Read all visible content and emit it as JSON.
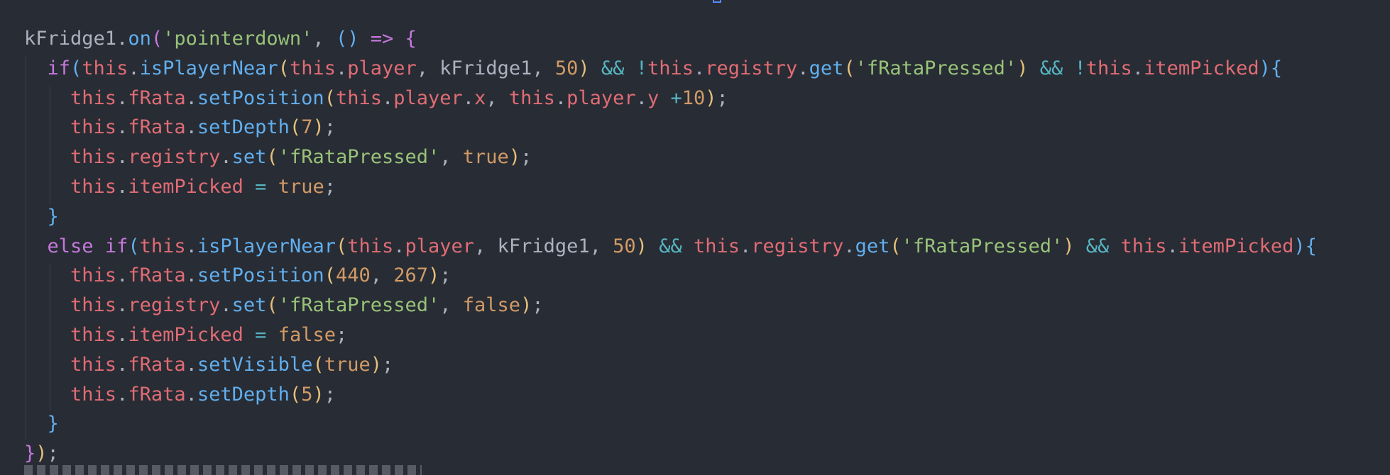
{
  "theme": {
    "background": "#282c34",
    "colors": {
      "plain": "#abb2bf",
      "keyword": "#c678dd",
      "this": "#e06c75",
      "prop": "#e06c75",
      "method": "#61afef",
      "string": "#98c379",
      "number": "#d19a66",
      "operator": "#56b6c2",
      "brace1": "#e5c07b",
      "brace2": "#c678dd",
      "brace3": "#61afef"
    }
  },
  "code_lines": [
    [
      [
        "kFridge1",
        "plain"
      ],
      [
        ".",
        "plain"
      ],
      [
        "on",
        "method"
      ],
      [
        "(",
        "brace2"
      ],
      [
        "'pointerdown'",
        "string"
      ],
      [
        ", ",
        "plain"
      ],
      [
        "()",
        "brace3"
      ],
      [
        " ",
        "plain"
      ],
      [
        "=>",
        "keyword"
      ],
      [
        " ",
        "plain"
      ],
      [
        "{",
        "brace2"
      ]
    ],
    [
      [
        "  ",
        "plain"
      ],
      [
        "if",
        "keyword"
      ],
      [
        "(",
        "brace3"
      ],
      [
        "this",
        "this"
      ],
      [
        ".",
        "plain"
      ],
      [
        "isPlayerNear",
        "method"
      ],
      [
        "(",
        "brace1"
      ],
      [
        "this",
        "this"
      ],
      [
        ".",
        "plain"
      ],
      [
        "player",
        "prop"
      ],
      [
        ", kFridge1, ",
        "plain"
      ],
      [
        "50",
        "number"
      ],
      [
        ")",
        "brace1"
      ],
      [
        " ",
        "plain"
      ],
      [
        "&&",
        "operator"
      ],
      [
        " ",
        "plain"
      ],
      [
        "!",
        "operator"
      ],
      [
        "this",
        "this"
      ],
      [
        ".",
        "plain"
      ],
      [
        "registry",
        "prop"
      ],
      [
        ".",
        "plain"
      ],
      [
        "get",
        "method"
      ],
      [
        "(",
        "brace1"
      ],
      [
        "'fRataPressed'",
        "string"
      ],
      [
        ")",
        "brace1"
      ],
      [
        " ",
        "plain"
      ],
      [
        "&&",
        "operator"
      ],
      [
        " ",
        "plain"
      ],
      [
        "!",
        "operator"
      ],
      [
        "this",
        "this"
      ],
      [
        ".",
        "plain"
      ],
      [
        "itemPicked",
        "prop"
      ],
      [
        ")",
        "brace3"
      ],
      [
        "{",
        "brace3"
      ]
    ],
    [
      [
        "    ",
        "plain"
      ],
      [
        "this",
        "this"
      ],
      [
        ".",
        "plain"
      ],
      [
        "fRata",
        "prop"
      ],
      [
        ".",
        "plain"
      ],
      [
        "setPosition",
        "method"
      ],
      [
        "(",
        "brace1"
      ],
      [
        "this",
        "this"
      ],
      [
        ".",
        "plain"
      ],
      [
        "player",
        "prop"
      ],
      [
        ".",
        "plain"
      ],
      [
        "x",
        "prop"
      ],
      [
        ", ",
        "plain"
      ],
      [
        "this",
        "this"
      ],
      [
        ".",
        "plain"
      ],
      [
        "player",
        "prop"
      ],
      [
        ".",
        "plain"
      ],
      [
        "y",
        "prop"
      ],
      [
        " ",
        "plain"
      ],
      [
        "+",
        "operator"
      ],
      [
        "10",
        "number"
      ],
      [
        ")",
        "brace1"
      ],
      [
        ";",
        "plain"
      ]
    ],
    [
      [
        "    ",
        "plain"
      ],
      [
        "this",
        "this"
      ],
      [
        ".",
        "plain"
      ],
      [
        "fRata",
        "prop"
      ],
      [
        ".",
        "plain"
      ],
      [
        "setDepth",
        "method"
      ],
      [
        "(",
        "brace1"
      ],
      [
        "7",
        "number"
      ],
      [
        ")",
        "brace1"
      ],
      [
        ";",
        "plain"
      ]
    ],
    [
      [
        "    ",
        "plain"
      ],
      [
        "this",
        "this"
      ],
      [
        ".",
        "plain"
      ],
      [
        "registry",
        "prop"
      ],
      [
        ".",
        "plain"
      ],
      [
        "set",
        "method"
      ],
      [
        "(",
        "brace1"
      ],
      [
        "'fRataPressed'",
        "string"
      ],
      [
        ", ",
        "plain"
      ],
      [
        "true",
        "number"
      ],
      [
        ")",
        "brace1"
      ],
      [
        ";",
        "plain"
      ]
    ],
    [
      [
        "    ",
        "plain"
      ],
      [
        "this",
        "this"
      ],
      [
        ".",
        "plain"
      ],
      [
        "itemPicked",
        "prop"
      ],
      [
        " ",
        "plain"
      ],
      [
        "=",
        "operator"
      ],
      [
        " ",
        "plain"
      ],
      [
        "true",
        "number"
      ],
      [
        ";",
        "plain"
      ]
    ],
    [
      [
        "  ",
        "plain"
      ],
      [
        "}",
        "brace3"
      ]
    ],
    [
      [
        "  ",
        "plain"
      ],
      [
        "else",
        "keyword"
      ],
      [
        " ",
        "plain"
      ],
      [
        "if",
        "keyword"
      ],
      [
        "(",
        "brace3"
      ],
      [
        "this",
        "this"
      ],
      [
        ".",
        "plain"
      ],
      [
        "isPlayerNear",
        "method"
      ],
      [
        "(",
        "brace1"
      ],
      [
        "this",
        "this"
      ],
      [
        ".",
        "plain"
      ],
      [
        "player",
        "prop"
      ],
      [
        ", kFridge1, ",
        "plain"
      ],
      [
        "50",
        "number"
      ],
      [
        ")",
        "brace1"
      ],
      [
        " ",
        "plain"
      ],
      [
        "&&",
        "operator"
      ],
      [
        " ",
        "plain"
      ],
      [
        "this",
        "this"
      ],
      [
        ".",
        "plain"
      ],
      [
        "registry",
        "prop"
      ],
      [
        ".",
        "plain"
      ],
      [
        "get",
        "method"
      ],
      [
        "(",
        "brace1"
      ],
      [
        "'fRataPressed'",
        "string"
      ],
      [
        ")",
        "brace1"
      ],
      [
        " ",
        "plain"
      ],
      [
        "&&",
        "operator"
      ],
      [
        " ",
        "plain"
      ],
      [
        "this",
        "this"
      ],
      [
        ".",
        "plain"
      ],
      [
        "itemPicked",
        "prop"
      ],
      [
        ")",
        "brace3"
      ],
      [
        "{",
        "brace3"
      ]
    ],
    [
      [
        "    ",
        "plain"
      ],
      [
        "this",
        "this"
      ],
      [
        ".",
        "plain"
      ],
      [
        "fRata",
        "prop"
      ],
      [
        ".",
        "plain"
      ],
      [
        "setPosition",
        "method"
      ],
      [
        "(",
        "brace1"
      ],
      [
        "440",
        "number"
      ],
      [
        ", ",
        "plain"
      ],
      [
        "267",
        "number"
      ],
      [
        ")",
        "brace1"
      ],
      [
        ";",
        "plain"
      ]
    ],
    [
      [
        "    ",
        "plain"
      ],
      [
        "this",
        "this"
      ],
      [
        ".",
        "plain"
      ],
      [
        "registry",
        "prop"
      ],
      [
        ".",
        "plain"
      ],
      [
        "set",
        "method"
      ],
      [
        "(",
        "brace1"
      ],
      [
        "'fRataPressed'",
        "string"
      ],
      [
        ", ",
        "plain"
      ],
      [
        "false",
        "number"
      ],
      [
        ")",
        "brace1"
      ],
      [
        ";",
        "plain"
      ]
    ],
    [
      [
        "    ",
        "plain"
      ],
      [
        "this",
        "this"
      ],
      [
        ".",
        "plain"
      ],
      [
        "itemPicked",
        "prop"
      ],
      [
        " ",
        "plain"
      ],
      [
        "=",
        "operator"
      ],
      [
        " ",
        "plain"
      ],
      [
        "false",
        "number"
      ],
      [
        ";",
        "plain"
      ]
    ],
    [
      [
        "    ",
        "plain"
      ],
      [
        "this",
        "this"
      ],
      [
        ".",
        "plain"
      ],
      [
        "fRata",
        "prop"
      ],
      [
        ".",
        "plain"
      ],
      [
        "setVisible",
        "method"
      ],
      [
        "(",
        "brace1"
      ],
      [
        "true",
        "number"
      ],
      [
        ")",
        "brace1"
      ],
      [
        ";",
        "plain"
      ]
    ],
    [
      [
        "    ",
        "plain"
      ],
      [
        "this",
        "this"
      ],
      [
        ".",
        "plain"
      ],
      [
        "fRata",
        "prop"
      ],
      [
        ".",
        "plain"
      ],
      [
        "setDepth",
        "method"
      ],
      [
        "(",
        "brace1"
      ],
      [
        "5",
        "number"
      ],
      [
        ")",
        "brace1"
      ],
      [
        ";",
        "plain"
      ]
    ],
    [
      [
        "  ",
        "plain"
      ],
      [
        "}",
        "brace3"
      ]
    ],
    [
      [
        "}",
        "brace2"
      ],
      [
        ")",
        "brace1"
      ],
      [
        ";",
        "plain"
      ]
    ]
  ]
}
